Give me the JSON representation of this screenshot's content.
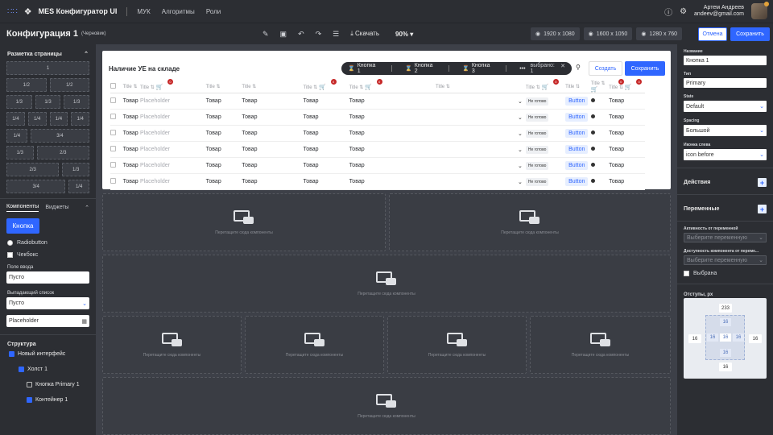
{
  "app": {
    "title": "MES Конфигуратор UI",
    "nav": [
      "МУК",
      "Алгоритмы",
      "Роли"
    ]
  },
  "user": {
    "name": "Артем Андреев",
    "email": "andeev@gmail.com"
  },
  "toolbar": {
    "title": "Конфигурация 1",
    "subtitle": "(Черновик)",
    "download": "Скачать",
    "zoom": "90%",
    "resolutions": [
      "1920 x 1080",
      "1600 x 1050",
      "1280 x 760"
    ],
    "cancel": "Отмена",
    "save": "Сохранить"
  },
  "left": {
    "layout_title": "Разметка страницы",
    "layout_rows": [
      [
        "1"
      ],
      [
        "1/2",
        "1/2"
      ],
      [
        "1/3",
        "1/3",
        "1/3"
      ],
      [
        "1/4",
        "1/4",
        "1/4",
        "1/4"
      ],
      [
        "1/4",
        "3/4"
      ],
      [
        "1/3",
        "2/3"
      ],
      [
        "2/3",
        "1/3"
      ],
      [
        "3/4",
        "1/4"
      ]
    ],
    "tabs": [
      "Компоненты",
      "Виджеты"
    ],
    "button": "Кнопка",
    "radio": "Radiobutton",
    "checkbox": "Чекбокс",
    "input_label": "Поле ввода",
    "input_value": "Пусто",
    "select_label": "Выпадающий список",
    "select_value": "Пусто",
    "date_placeholder": "Placeholder",
    "structure_title": "Структура",
    "tree": [
      "Новый интерфейс",
      "Холст 1",
      "Кнопка Primary 1",
      "Контейнер 1"
    ]
  },
  "card": {
    "title": "Наличие УЕ на складе",
    "pill": {
      "buttons": [
        "Кнопка 1",
        "Кнопка 2",
        "Кнопка 3"
      ],
      "more": "•••",
      "selected": "выбрано: 1"
    },
    "create": "Создать",
    "save": "Сохранить",
    "headers": [
      "Title",
      "Title",
      "Title",
      "Title",
      "Title",
      "Title",
      "Title",
      "Title",
      "Title",
      "Title",
      "Title"
    ],
    "rows": [
      [
        "Товар",
        "Placeholder",
        "Товар",
        "Товар",
        "Товар",
        "Товар",
        "Не готово",
        "Button",
        "Товар"
      ],
      [
        "Товар",
        "Placeholder",
        "Товар",
        "Товар",
        "Товар",
        "Товар",
        "Не готово",
        "Button",
        "Товар"
      ],
      [
        "Товар",
        "Placeholder",
        "Товар",
        "Товар",
        "Товар",
        "Товар",
        "Не готово",
        "Button",
        "Товар"
      ],
      [
        "Товар",
        "Placeholder",
        "Товар",
        "Товар",
        "Товар",
        "Товар",
        "Не готово",
        "Button",
        "Товар"
      ],
      [
        "Товар",
        "Placeholder",
        "Товар",
        "Товар",
        "Товар",
        "Товар",
        "Не готово",
        "Button",
        "Товар"
      ],
      [
        "Товар",
        "Placeholder",
        "Товар",
        "Товар",
        "Товар",
        "Товар",
        "Не готово",
        "Button",
        "Товар"
      ]
    ],
    "badge": "0"
  },
  "dropzone_text": "Перетащите сюда компоненты",
  "right": {
    "name_label": "Название",
    "name_value": "Кнопка 1",
    "type_label": "Тип",
    "type_value": "Primary",
    "state_label": "State",
    "state_value": "Default",
    "spacing_label": "Spacing",
    "spacing_value": "Большой",
    "icon_label": "Иконка слева",
    "icon_value": "icon before",
    "actions": "Действия",
    "variables": "Переменные",
    "activity_label": "Активность от переменной",
    "activity_ph": "Выберите переменную",
    "avail_label": "Доступность компонента от переме...",
    "avail_ph": "Выберите переменную",
    "selected": "Выбрана",
    "padding_title": "Отступы, px",
    "padding": {
      "top": "233",
      "left": "16",
      "right": "16",
      "bottom": "16",
      "in_top": "16",
      "in_left": "16",
      "in_center": "16",
      "in_right": "16",
      "in_bottom": "16"
    }
  }
}
